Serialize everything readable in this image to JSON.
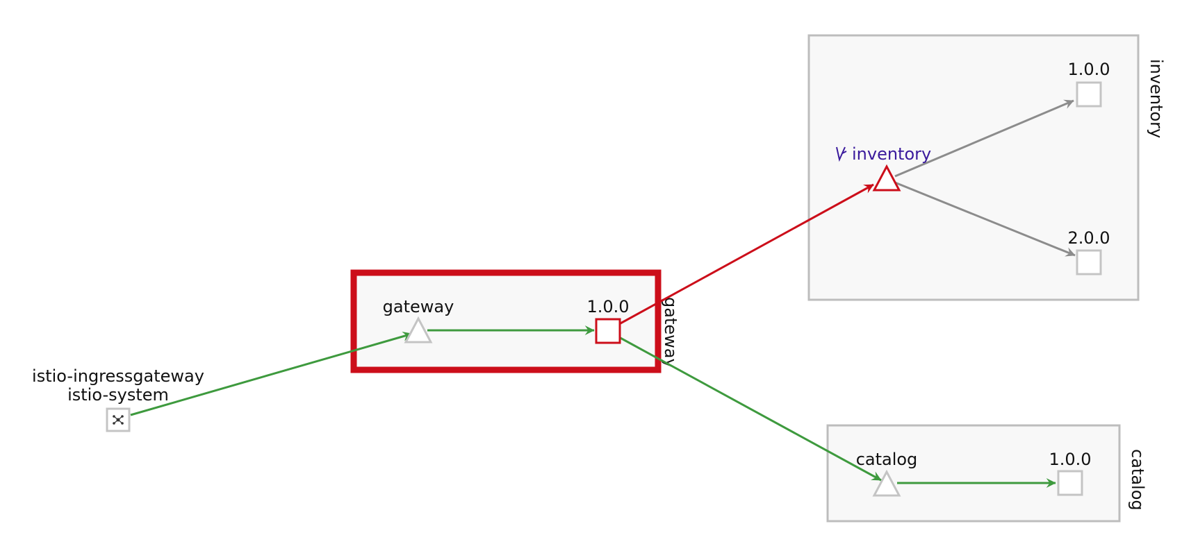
{
  "colors": {
    "healthy_edge": "#3e9a3e",
    "error_edge": "#cc0e1a",
    "idle_edge": "#8c8c8c",
    "virtual_service": "#3a1a9c",
    "box_border": "#bdbdbd",
    "box_fill": "#f8f8f8",
    "node_border": "#c4c4c4"
  },
  "boxes": {
    "gateway": {
      "label": "gateway",
      "state": "error"
    },
    "inventory": {
      "label": "inventory",
      "state": "normal"
    },
    "catalog": {
      "label": "catalog",
      "state": "normal"
    }
  },
  "nodes": {
    "ingress": {
      "label": "istio-ingressgateway",
      "namespace": "istio-system",
      "shape": "square",
      "icon": "cluster-icon"
    },
    "gateway_svc": {
      "label": "gateway",
      "shape": "triangle"
    },
    "gateway_v1": {
      "label": "1.0.0",
      "shape": "square",
      "state": "error"
    },
    "inventory_svc": {
      "label": "inventory",
      "shape": "triangle",
      "state": "error",
      "icon": "virtual-service-icon"
    },
    "inventory_v1": {
      "label": "1.0.0",
      "shape": "square"
    },
    "inventory_v2": {
      "label": "2.0.0",
      "shape": "square"
    },
    "catalog_svc": {
      "label": "catalog",
      "shape": "triangle"
    },
    "catalog_v1": {
      "label": "1.0.0",
      "shape": "square"
    }
  },
  "edges": [
    {
      "from": "ingress",
      "to": "gateway_svc",
      "state": "healthy"
    },
    {
      "from": "gateway_svc",
      "to": "gateway_v1",
      "state": "healthy"
    },
    {
      "from": "gateway_v1",
      "to": "inventory_svc",
      "state": "error"
    },
    {
      "from": "gateway_v1",
      "to": "catalog_svc",
      "state": "healthy"
    },
    {
      "from": "inventory_svc",
      "to": "inventory_v1",
      "state": "idle"
    },
    {
      "from": "inventory_svc",
      "to": "inventory_v2",
      "state": "idle"
    },
    {
      "from": "catalog_svc",
      "to": "catalog_v1",
      "state": "healthy"
    }
  ]
}
